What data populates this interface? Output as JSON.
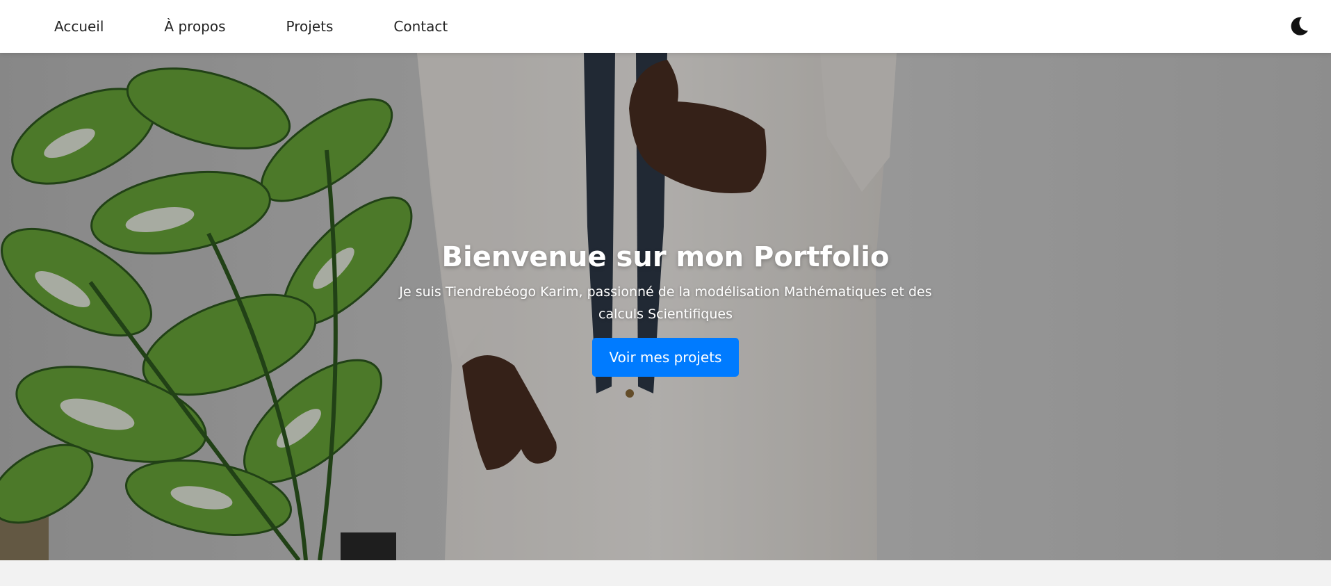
{
  "nav": {
    "items": [
      {
        "label": "Accueil"
      },
      {
        "label": "À propos"
      },
      {
        "label": "Projets"
      },
      {
        "label": "Contact"
      }
    ],
    "theme_toggle_icon": "moon-icon"
  },
  "hero": {
    "title": "Bienvenue sur mon Portfolio",
    "subtitle": "Je suis Tiendrebéogo Karim, passionné de la modélisation Mathématiques et des calculs Scientifiques",
    "cta_label": "Voir mes projets",
    "background": "photo-person-with-plant"
  },
  "colors": {
    "accent": "#007bff",
    "nav_bg": "#ffffff",
    "page_bg": "#f2f2f2"
  }
}
